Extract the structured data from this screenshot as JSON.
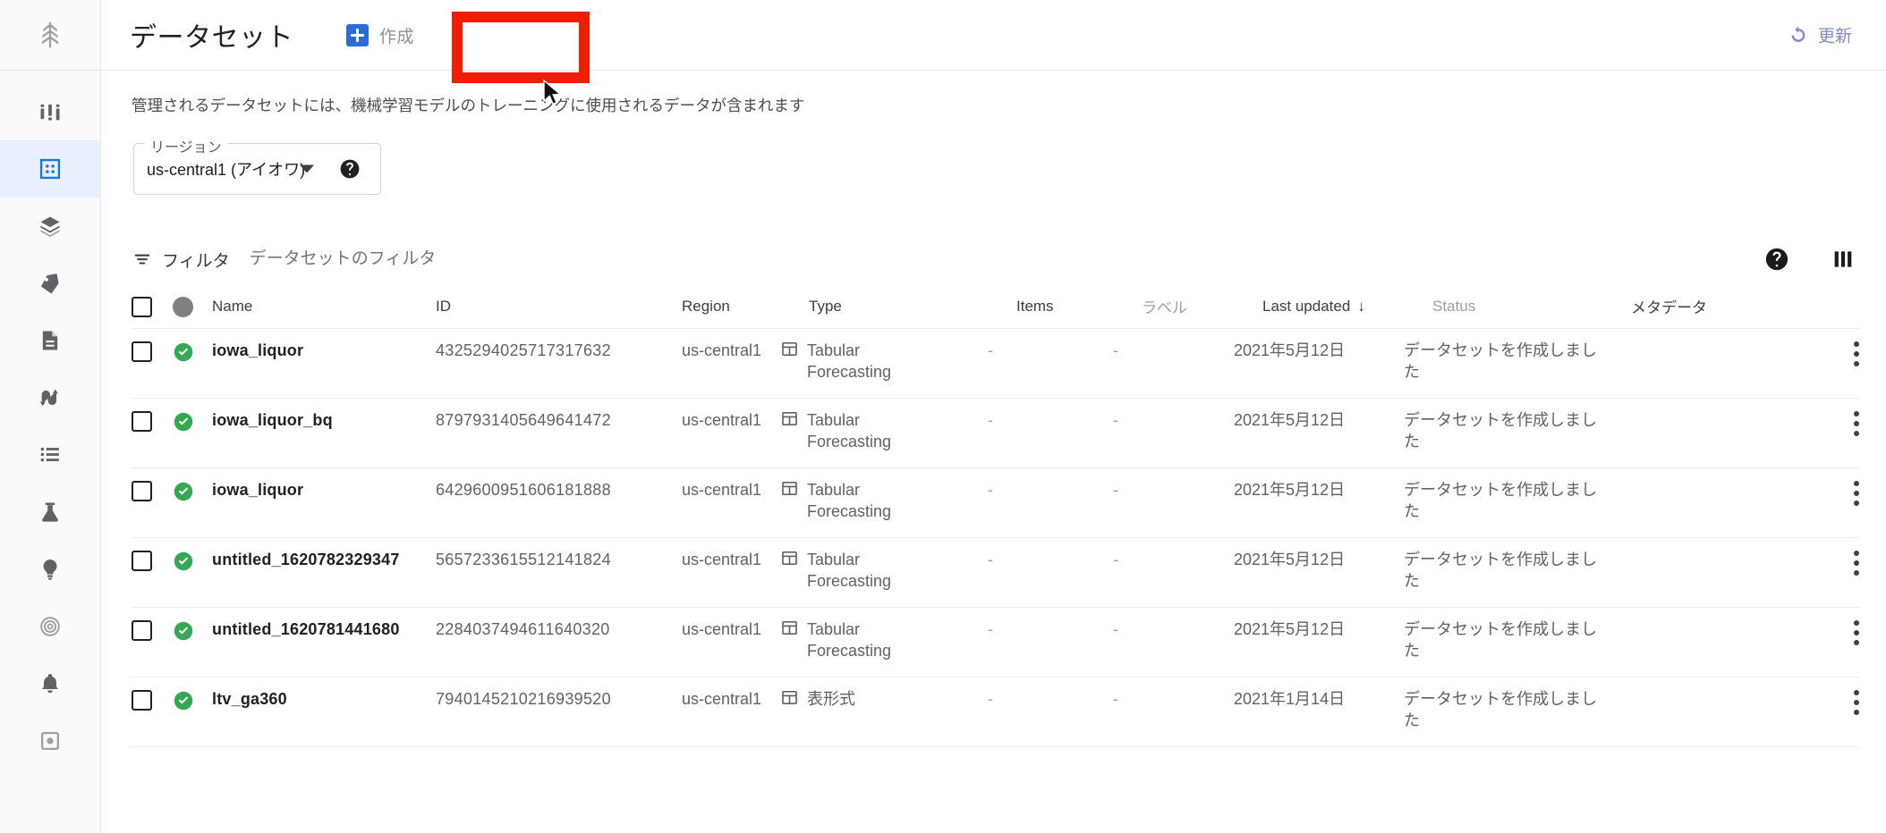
{
  "colors": {
    "accent_blue": "#1a73e8",
    "create_button_blue": "#2c6bd6",
    "highlight_red": "#f01d00",
    "selected_nav_bg": "#e8f0fe",
    "status_green": "#34a853",
    "muted_text": "#9aa0a6"
  },
  "sidebar": {
    "logo_icon": "vertex-ai-logo-icon",
    "items": [
      {
        "icon": "dashboard-icon",
        "name": "dashboard",
        "selected": false
      },
      {
        "icon": "datasets-grid-icon",
        "name": "datasets",
        "selected": true
      },
      {
        "icon": "layers-icon",
        "name": "features",
        "selected": false
      },
      {
        "icon": "label-tag-icon",
        "name": "labeling-tasks",
        "selected": false
      },
      {
        "icon": "notebook-icon",
        "name": "workbench",
        "selected": false
      },
      {
        "icon": "pipelines-icon",
        "name": "pipelines",
        "selected": false
      },
      {
        "icon": "list-icon",
        "name": "training",
        "selected": false
      },
      {
        "icon": "flask-icon",
        "name": "experiments",
        "selected": false
      },
      {
        "icon": "lightbulb-icon",
        "name": "models",
        "selected": false
      },
      {
        "icon": "target-icon",
        "name": "endpoints",
        "selected": false
      },
      {
        "icon": "bell-icon",
        "name": "monitoring",
        "selected": false
      },
      {
        "icon": "batch-icon",
        "name": "batch-predictions",
        "selected": false
      }
    ]
  },
  "header": {
    "title": "データセット",
    "create_label": "作成",
    "create_icon": "plus-square-icon",
    "refresh_label": "更新",
    "refresh_icon": "refresh-icon"
  },
  "description": "管理されるデータセットには、機械学習モデルのトレーニングに使用されるデータが含まれます",
  "region": {
    "legend": "リージョン",
    "value": "us-central1 (アイオワ)",
    "caret_icon": "chevron-down-icon",
    "help_icon": "help-circle-icon"
  },
  "filter": {
    "icon": "filter-icon",
    "label": "フィルタ",
    "placeholder": "データセットのフィルタ",
    "help_icon": "help-circle-icon",
    "columns_icon": "column-settings-icon"
  },
  "table": {
    "headers": {
      "checkbox": "select-all-checkbox",
      "status_dot": "status-column-icon",
      "name": "Name",
      "id": "ID",
      "region": "Region",
      "type": "Type",
      "items": "Items",
      "labels": "ラベル",
      "last_updated": "Last updated",
      "sort_arrow": "↓",
      "status": "Status",
      "metadata": "メタデータ"
    },
    "rows": [
      {
        "status_icon": "check-circle-icon",
        "name": "iowa_liquor",
        "id": "4325294025717317632",
        "region": "us-central1",
        "type": "Tabular Forecasting",
        "type_icon": "table-icon",
        "items": "-",
        "labels": "-",
        "last_updated": "2021年5月12日",
        "status": "データセットを作成しました",
        "metadata": ""
      },
      {
        "status_icon": "check-circle-icon",
        "name": "iowa_liquor_bq",
        "id": "8797931405649641472",
        "region": "us-central1",
        "type": "Tabular Forecasting",
        "type_icon": "table-icon",
        "items": "-",
        "labels": "-",
        "last_updated": "2021年5月12日",
        "status": "データセットを作成しました",
        "metadata": ""
      },
      {
        "status_icon": "check-circle-icon",
        "name": "iowa_liquor",
        "id": "6429600951606181888",
        "region": "us-central1",
        "type": "Tabular Forecasting",
        "type_icon": "table-icon",
        "items": "-",
        "labels": "-",
        "last_updated": "2021年5月12日",
        "status": "データセットを作成しました",
        "metadata": ""
      },
      {
        "status_icon": "check-circle-icon",
        "name": "untitled_1620782329347",
        "id": "5657233615512141824",
        "region": "us-central1",
        "type": "Tabular Forecasting",
        "type_icon": "table-icon",
        "items": "-",
        "labels": "-",
        "last_updated": "2021年5月12日",
        "status": "データセットを作成しました",
        "metadata": ""
      },
      {
        "status_icon": "check-circle-icon",
        "name": "untitled_1620781441680",
        "id": "2284037494611640320",
        "region": "us-central1",
        "type": "Tabular Forecasting",
        "type_icon": "table-icon",
        "items": "-",
        "labels": "-",
        "last_updated": "2021年5月12日",
        "status": "データセットを作成しました",
        "metadata": ""
      },
      {
        "status_icon": "check-circle-icon",
        "name": "ltv_ga360",
        "id": "7940145210216939520",
        "region": "us-central1",
        "type": "表形式",
        "type_icon": "table-icon",
        "items": "-",
        "labels": "-",
        "last_updated": "2021年1月14日",
        "status": "データセットを作成しました",
        "metadata": ""
      }
    ],
    "row_menu_icon": "kebab-menu-icon"
  }
}
